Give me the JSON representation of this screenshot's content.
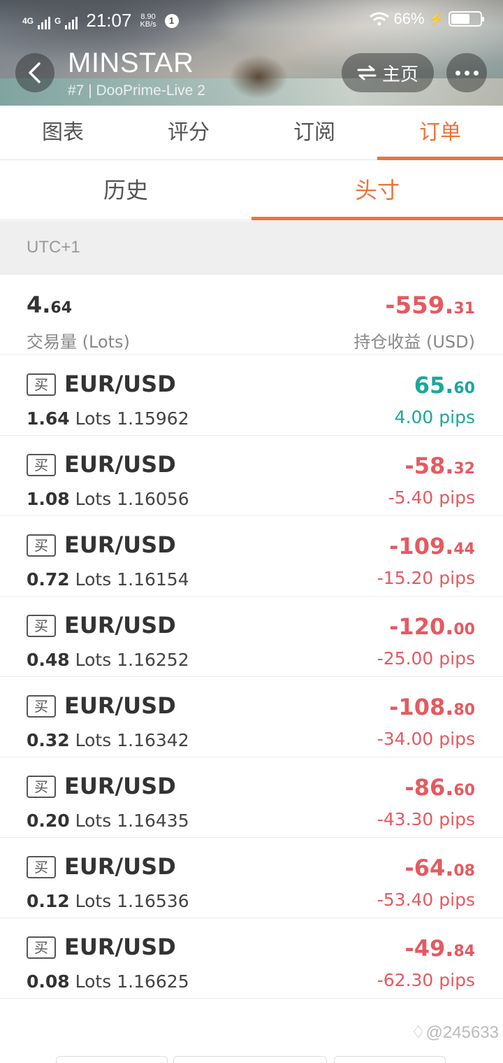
{
  "status_bar": {
    "network_1": "4G",
    "network_2": "G",
    "time": "21:07",
    "speed_value": "8.90",
    "speed_unit": "KB/s",
    "notification_count": "1",
    "battery_percent": "66%",
    "battery_level": 0.66
  },
  "header": {
    "trader_name": "MINSTAR",
    "subtitle": "#7 | DooPrime-Live 2",
    "home_label": "主页"
  },
  "main_tabs": [
    {
      "label": "图表",
      "active": false
    },
    {
      "label": "评分",
      "active": false
    },
    {
      "label": "订阅",
      "active": false
    },
    {
      "label": "订单",
      "active": true
    }
  ],
  "sub_tabs": [
    {
      "label": "历史",
      "active": false
    },
    {
      "label": "头寸",
      "active": true
    }
  ],
  "timezone": "UTC+1",
  "summary": {
    "volume_int": "4.",
    "volume_dec": "64",
    "volume_label": "交易量 (Lots)",
    "pnl_int": "-559.",
    "pnl_dec": "31",
    "pnl_label": "持仓收益 (USD)"
  },
  "orders": [
    {
      "side": "买",
      "symbol": "EUR/USD",
      "lots": "1.64",
      "lots_unit": "Lots",
      "price": "1.15962",
      "profit_int": "65.",
      "profit_dec": "60",
      "pips": "4.00 pips",
      "positive": true
    },
    {
      "side": "买",
      "symbol": "EUR/USD",
      "lots": "1.08",
      "lots_unit": "Lots",
      "price": "1.16056",
      "profit_int": "-58.",
      "profit_dec": "32",
      "pips": "-5.40 pips",
      "positive": false
    },
    {
      "side": "买",
      "symbol": "EUR/USD",
      "lots": "0.72",
      "lots_unit": "Lots",
      "price": "1.16154",
      "profit_int": "-109.",
      "profit_dec": "44",
      "pips": "-15.20 pips",
      "positive": false
    },
    {
      "side": "买",
      "symbol": "EUR/USD",
      "lots": "0.48",
      "lots_unit": "Lots",
      "price": "1.16252",
      "profit_int": "-120.",
      "profit_dec": "00",
      "pips": "-25.00 pips",
      "positive": false
    },
    {
      "side": "买",
      "symbol": "EUR/USD",
      "lots": "0.32",
      "lots_unit": "Lots",
      "price": "1.16342",
      "profit_int": "-108.",
      "profit_dec": "80",
      "pips": "-34.00 pips",
      "positive": false
    },
    {
      "side": "买",
      "symbol": "EUR/USD",
      "lots": "0.20",
      "lots_unit": "Lots",
      "price": "1.16435",
      "profit_int": "-86.",
      "profit_dec": "60",
      "pips": "-43.30 pips",
      "positive": false
    },
    {
      "side": "买",
      "symbol": "EUR/USD",
      "lots": "0.12",
      "lots_unit": "Lots",
      "price": "1.16536",
      "profit_int": "-64.",
      "profit_dec": "08",
      "pips": "-53.40 pips",
      "positive": false
    },
    {
      "side": "买",
      "symbol": "EUR/USD",
      "lots": "0.08",
      "lots_unit": "Lots",
      "price": "1.16625",
      "profit_int": "-49.",
      "profit_dec": "84",
      "pips": "-62.30 pips",
      "positive": false
    }
  ],
  "watermark": "@245633",
  "colors": {
    "accent": "#f0723a",
    "positive": "#1aa89a",
    "negative": "#e55a5f"
  }
}
